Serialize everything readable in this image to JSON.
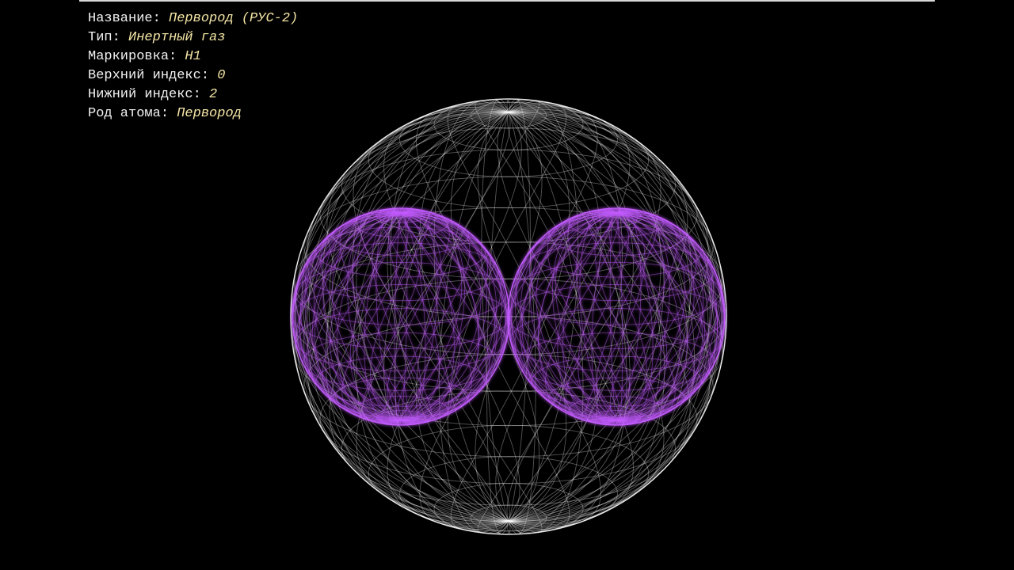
{
  "info": {
    "rows": [
      {
        "label": "Название:",
        "value": "Первород (РУС-2)"
      },
      {
        "label": "Тип:",
        "value": "Инертный газ"
      },
      {
        "label": "Маркировка:",
        "value": "H1"
      },
      {
        "label": "Верхний индекс:",
        "value": "0"
      },
      {
        "label": "Нижний индекс:",
        "value": "2"
      },
      {
        "label": "Род атома:",
        "value": "Первород"
      }
    ]
  },
  "colors": {
    "background": "#000000",
    "outer_sphere": "#ffffff",
    "inner_spheres": "#c45cff",
    "label_text": "#f2f2f2",
    "value_text": "#f5e6a6"
  },
  "icons": {
    "outer": "wireframe-sphere-icon",
    "inner": "glowing-wireframe-sphere-icon"
  }
}
